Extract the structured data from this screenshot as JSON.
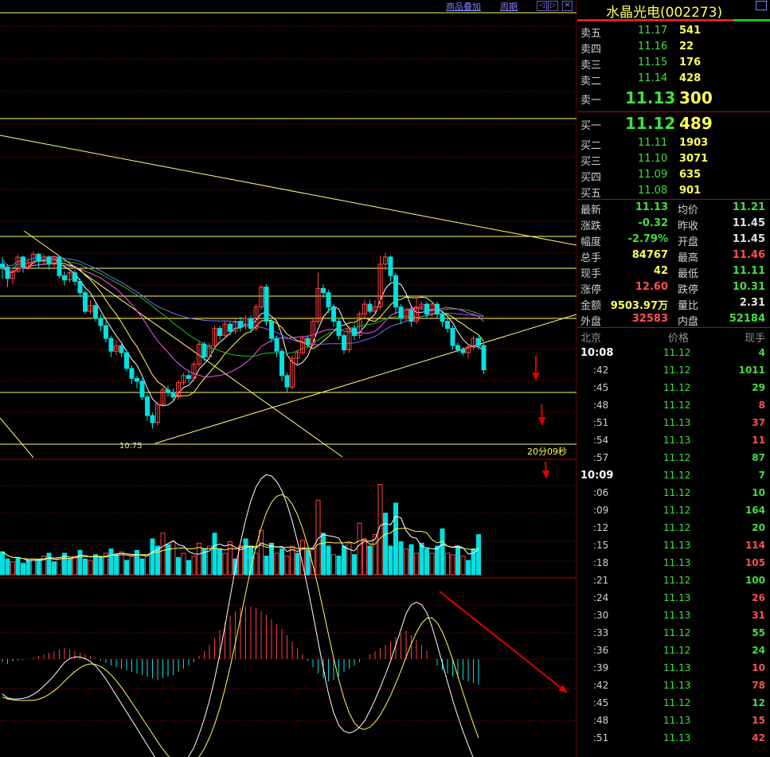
{
  "toolbar": {
    "overlay_label": "商品叠加",
    "period_label": "周期",
    "nav_prev": "◁",
    "nav_next": "▷",
    "nav_close": "✕"
  },
  "chart": {
    "low_label": "10.75",
    "countdown_label": "20分09秒"
  },
  "quote": {
    "title": "水晶光电(002273)",
    "sell": [
      {
        "label": "卖五",
        "price": "11.17",
        "qty": "541"
      },
      {
        "label": "卖四",
        "price": "11.16",
        "qty": "22"
      },
      {
        "label": "卖三",
        "price": "11.15",
        "qty": "176"
      },
      {
        "label": "卖二",
        "price": "11.14",
        "qty": "428"
      },
      {
        "label": "卖一",
        "price": "11.13",
        "qty": "300"
      }
    ],
    "buy": [
      {
        "label": "买一",
        "price": "11.12",
        "qty": "489"
      },
      {
        "label": "买二",
        "price": "11.11",
        "qty": "1903"
      },
      {
        "label": "买三",
        "price": "11.10",
        "qty": "3071"
      },
      {
        "label": "买四",
        "price": "11.09",
        "qty": "635"
      },
      {
        "label": "买五",
        "price": "11.08",
        "qty": "901"
      }
    ],
    "stats": [
      {
        "l1": "最新",
        "v1": "11.13",
        "c1": "g",
        "l2": "均价",
        "v2": "11.21",
        "c2": "g"
      },
      {
        "l1": "涨跌",
        "v1": "-0.32",
        "c1": "g",
        "l2": "昨收",
        "v2": "11.45",
        "c2": "w"
      },
      {
        "l1": "幅度",
        "v1": "-2.79%",
        "c1": "g",
        "l2": "开盘",
        "v2": "11.45",
        "c2": "w"
      },
      {
        "l1": "总手",
        "v1": "84767",
        "c1": "y",
        "l2": "最高",
        "v2": "11.46",
        "c2": "r"
      },
      {
        "l1": "现手",
        "v1": "42",
        "c1": "y",
        "l2": "最低",
        "v2": "11.11",
        "c2": "g"
      },
      {
        "l1": "涨停",
        "v1": "12.60",
        "c1": "r",
        "l2": "跌停",
        "v2": "10.31",
        "c2": "g"
      },
      {
        "l1": "金额",
        "v1": "9503.97万",
        "c1": "y",
        "l2": "量比",
        "v2": "2.31",
        "c2": "w"
      },
      {
        "l1": "外盘",
        "v1": "32583",
        "c1": "r",
        "l2": "内盘",
        "v2": "52184",
        "c2": "g"
      }
    ],
    "ticks_header": {
      "time": "北京",
      "price": "价格",
      "vol": "现手"
    },
    "ticks": [
      {
        "time": "10:08",
        "price": "11.12",
        "vol": "4",
        "c": "g",
        "hour": true
      },
      {
        "time": ":42",
        "price": "11.12",
        "vol": "1011",
        "c": "g"
      },
      {
        "time": ":45",
        "price": "11.12",
        "vol": "29",
        "c": "g"
      },
      {
        "time": ":48",
        "price": "11.12",
        "vol": "8",
        "c": "r"
      },
      {
        "time": ":51",
        "price": "11.13",
        "vol": "37",
        "c": "r"
      },
      {
        "time": ":54",
        "price": "11.13",
        "vol": "11",
        "c": "r"
      },
      {
        "time": ":57",
        "price": "11.12",
        "vol": "87",
        "c": "g"
      },
      {
        "time": "10:09",
        "price": "11.12",
        "vol": "7",
        "c": "g",
        "hour": true
      },
      {
        "time": ":06",
        "price": "11.12",
        "vol": "10",
        "c": "g"
      },
      {
        "time": ":09",
        "price": "11.12",
        "vol": "164",
        "c": "g"
      },
      {
        "time": ":12",
        "price": "11.12",
        "vol": "20",
        "c": "g"
      },
      {
        "time": ":15",
        "price": "11.13",
        "vol": "114",
        "c": "r"
      },
      {
        "time": ":18",
        "price": "11.13",
        "vol": "105",
        "c": "r"
      },
      {
        "time": ":21",
        "price": "11.12",
        "vol": "100",
        "c": "g"
      },
      {
        "time": ":24",
        "price": "11.13",
        "vol": "26",
        "c": "r"
      },
      {
        "time": ":30",
        "price": "11.13",
        "vol": "31",
        "c": "r"
      },
      {
        "time": ":33",
        "price": "11.12",
        "vol": "55",
        "c": "g"
      },
      {
        "time": ":36",
        "price": "11.12",
        "vol": "24",
        "c": "g"
      },
      {
        "time": ":39",
        "price": "11.13",
        "vol": "10",
        "c": "r"
      },
      {
        "time": ":42",
        "price": "11.13",
        "vol": "78",
        "c": "r"
      },
      {
        "time": ":45",
        "price": "11.12",
        "vol": "12",
        "c": "g"
      },
      {
        "time": ":48",
        "price": "11.13",
        "vol": "15",
        "c": "r"
      },
      {
        "time": ":51",
        "price": "11.13",
        "vol": "42",
        "c": "r"
      }
    ]
  },
  "colors": {
    "up": "#ff4040",
    "down": "#00e0e0",
    "ma5": "#ffffff",
    "ma10": "#ffff54",
    "ma20": "#ff50ff",
    "ma30": "#20c020",
    "ma60": "#7070ff",
    "trend": "#ffff80",
    "grid": "#900000",
    "annot": "#e00000",
    "price_green": "#40e040",
    "volume_gold": "#ffff54"
  },
  "chart_data": {
    "type": "candlestick",
    "candles": [
      [
        11.9,
        11.88,
        11.95,
        11.8
      ],
      [
        11.88,
        11.8,
        11.9,
        11.74
      ],
      [
        11.8,
        11.85,
        11.88,
        11.76
      ],
      [
        11.85,
        11.95,
        11.97,
        11.84
      ],
      [
        11.95,
        11.88,
        11.96,
        11.84
      ],
      [
        11.88,
        11.91,
        11.94,
        11.86
      ],
      [
        11.91,
        11.97,
        11.99,
        11.9
      ],
      [
        11.97,
        11.92,
        11.98,
        11.87
      ],
      [
        11.92,
        11.95,
        11.97,
        11.89
      ],
      [
        11.95,
        11.9,
        11.96,
        11.86
      ],
      [
        11.9,
        11.95,
        11.96,
        11.87
      ],
      [
        11.95,
        11.82,
        11.96,
        11.8
      ],
      [
        11.82,
        11.79,
        11.85,
        11.75
      ],
      [
        11.79,
        11.84,
        11.86,
        11.77
      ],
      [
        11.84,
        11.78,
        11.86,
        11.75
      ],
      [
        11.78,
        11.7,
        11.8,
        11.67
      ],
      [
        11.7,
        11.57,
        11.72,
        11.55
      ],
      [
        11.57,
        11.61,
        11.65,
        11.55
      ],
      [
        11.61,
        11.52,
        11.63,
        11.5
      ],
      [
        11.52,
        11.47,
        11.55,
        11.43
      ],
      [
        11.47,
        11.38,
        11.5,
        11.35
      ],
      [
        11.38,
        11.29,
        11.4,
        11.25
      ],
      [
        11.29,
        11.33,
        11.37,
        11.26
      ],
      [
        11.33,
        11.28,
        11.35,
        11.25
      ],
      [
        11.28,
        11.17,
        11.3,
        11.15
      ],
      [
        11.17,
        11.1,
        11.19,
        11.06
      ],
      [
        11.1,
        11.08,
        11.12,
        11.03
      ],
      [
        11.08,
        10.97,
        11.1,
        10.95
      ],
      [
        10.97,
        10.84,
        10.99,
        10.8
      ],
      [
        10.84,
        10.79,
        10.86,
        10.75
      ],
      [
        10.79,
        10.92,
        10.94,
        10.77
      ],
      [
        10.92,
        11.02,
        11.04,
        10.9
      ],
      [
        11.02,
        11.0,
        11.05,
        10.97
      ],
      [
        11.0,
        10.97,
        11.03,
        10.94
      ],
      [
        10.97,
        11.07,
        11.09,
        10.95
      ],
      [
        11.07,
        11.12,
        11.14,
        11.05
      ],
      [
        11.12,
        11.1,
        11.15,
        11.07
      ],
      [
        11.1,
        11.2,
        11.22,
        11.08
      ],
      [
        11.2,
        11.34,
        11.36,
        11.18
      ],
      [
        11.34,
        11.25,
        11.36,
        11.22
      ],
      [
        11.25,
        11.33,
        11.35,
        11.23
      ],
      [
        11.33,
        11.45,
        11.47,
        11.31
      ],
      [
        11.45,
        11.4,
        11.47,
        11.37
      ],
      [
        11.4,
        11.48,
        11.5,
        11.38
      ],
      [
        11.48,
        11.43,
        11.5,
        11.4
      ],
      [
        11.43,
        11.5,
        11.52,
        11.41
      ],
      [
        11.5,
        11.46,
        11.53,
        11.43
      ],
      [
        11.46,
        11.52,
        11.54,
        11.44
      ],
      [
        11.52,
        11.45,
        11.54,
        11.42
      ],
      [
        11.45,
        11.6,
        11.62,
        11.43
      ],
      [
        11.6,
        11.74,
        11.75,
        11.58
      ],
      [
        11.74,
        11.5,
        11.76,
        11.47
      ],
      [
        11.5,
        11.38,
        11.52,
        11.35
      ],
      [
        11.38,
        11.29,
        11.4,
        11.25
      ],
      [
        11.29,
        11.12,
        11.31,
        11.08
      ],
      [
        11.12,
        11.04,
        11.14,
        11.0
      ],
      [
        11.04,
        11.24,
        11.26,
        11.02
      ],
      [
        11.24,
        11.28,
        11.3,
        11.2
      ],
      [
        11.28,
        11.38,
        11.4,
        11.26
      ],
      [
        11.38,
        11.34,
        11.4,
        11.31
      ],
      [
        11.34,
        11.5,
        11.52,
        11.32
      ],
      [
        11.5,
        11.73,
        11.84,
        11.48
      ],
      [
        11.73,
        11.7,
        11.76,
        11.66
      ],
      [
        11.7,
        11.6,
        11.72,
        11.56
      ],
      [
        11.6,
        11.5,
        11.62,
        11.46
      ],
      [
        11.5,
        11.4,
        11.52,
        11.37
      ],
      [
        11.4,
        11.3,
        11.42,
        11.27
      ],
      [
        11.3,
        11.45,
        11.47,
        11.28
      ],
      [
        11.45,
        11.4,
        11.48,
        11.37
      ],
      [
        11.4,
        11.55,
        11.57,
        11.38
      ],
      [
        11.55,
        11.62,
        11.65,
        11.52
      ],
      [
        11.62,
        11.57,
        11.65,
        11.55
      ],
      [
        11.57,
        11.6,
        11.65,
        11.55
      ],
      [
        11.6,
        11.9,
        11.96,
        11.58
      ],
      [
        11.9,
        11.95,
        11.98,
        11.86
      ],
      [
        11.95,
        11.82,
        11.96,
        11.78
      ],
      [
        11.82,
        11.6,
        11.84,
        11.55
      ],
      [
        11.6,
        11.52,
        11.62,
        11.48
      ],
      [
        11.52,
        11.58,
        11.6,
        11.5
      ],
      [
        11.58,
        11.5,
        11.6,
        11.46
      ],
      [
        11.5,
        11.6,
        11.68,
        11.48
      ],
      [
        11.6,
        11.62,
        11.64,
        11.58
      ],
      [
        11.62,
        11.55,
        11.64,
        11.52
      ],
      [
        11.55,
        11.62,
        11.64,
        11.53
      ],
      [
        11.62,
        11.55,
        11.64,
        11.52
      ],
      [
        11.55,
        11.5,
        11.57,
        11.46
      ],
      [
        11.5,
        11.45,
        11.52,
        11.42
      ],
      [
        11.45,
        11.33,
        11.47,
        11.3
      ],
      [
        11.33,
        11.3,
        11.35,
        11.28
      ],
      [
        11.3,
        11.28,
        11.32,
        11.26
      ],
      [
        11.28,
        11.32,
        11.34,
        11.24
      ],
      [
        11.32,
        11.38,
        11.4,
        11.3
      ],
      [
        11.38,
        11.33,
        11.4,
        11.3
      ],
      [
        11.33,
        11.16,
        11.35,
        11.13
      ]
    ],
    "volume": [
      [
        32,
        "d"
      ],
      [
        22,
        "d"
      ],
      [
        18,
        "u"
      ],
      [
        24,
        "d"
      ],
      [
        16,
        "d"
      ],
      [
        20,
        "d"
      ],
      [
        22,
        "u"
      ],
      [
        20,
        "d"
      ],
      [
        26,
        "u"
      ],
      [
        30,
        "d"
      ],
      [
        18,
        "d"
      ],
      [
        24,
        "u"
      ],
      [
        30,
        "d"
      ],
      [
        22,
        "d"
      ],
      [
        26,
        "u"
      ],
      [
        34,
        "d"
      ],
      [
        22,
        "d"
      ],
      [
        20,
        "u"
      ],
      [
        28,
        "d"
      ],
      [
        24,
        "d"
      ],
      [
        30,
        "u"
      ],
      [
        36,
        "d"
      ],
      [
        28,
        "d"
      ],
      [
        32,
        "u"
      ],
      [
        20,
        "d"
      ],
      [
        26,
        "u"
      ],
      [
        34,
        "d"
      ],
      [
        22,
        "d"
      ],
      [
        28,
        "u"
      ],
      [
        50,
        "d"
      ],
      [
        40,
        "d"
      ],
      [
        58,
        "u"
      ],
      [
        42,
        "d"
      ],
      [
        46,
        "u"
      ],
      [
        24,
        "d"
      ],
      [
        30,
        "u"
      ],
      [
        20,
        "d"
      ],
      [
        26,
        "u"
      ],
      [
        44,
        "u"
      ],
      [
        36,
        "d"
      ],
      [
        40,
        "u"
      ],
      [
        58,
        "d"
      ],
      [
        36,
        "d"
      ],
      [
        30,
        "u"
      ],
      [
        46,
        "u"
      ],
      [
        22,
        "d"
      ],
      [
        40,
        "u"
      ],
      [
        50,
        "d"
      ],
      [
        40,
        "d"
      ],
      [
        30,
        "u"
      ],
      [
        62,
        "u"
      ],
      [
        26,
        "d"
      ],
      [
        44,
        "d"
      ],
      [
        30,
        "u"
      ],
      [
        36,
        "d"
      ],
      [
        26,
        "u"
      ],
      [
        40,
        "u"
      ],
      [
        30,
        "d"
      ],
      [
        48,
        "u"
      ],
      [
        34,
        "d"
      ],
      [
        36,
        "u"
      ],
      [
        104,
        "u"
      ],
      [
        58,
        "d"
      ],
      [
        40,
        "d"
      ],
      [
        28,
        "u"
      ],
      [
        26,
        "d"
      ],
      [
        40,
        "d"
      ],
      [
        44,
        "u"
      ],
      [
        28,
        "d"
      ],
      [
        72,
        "u"
      ],
      [
        50,
        "u"
      ],
      [
        40,
        "d"
      ],
      [
        56,
        "u"
      ],
      [
        126,
        "u"
      ],
      [
        86,
        "d"
      ],
      [
        40,
        "d"
      ],
      [
        100,
        "d"
      ],
      [
        46,
        "d"
      ],
      [
        36,
        "u"
      ],
      [
        42,
        "d"
      ],
      [
        30,
        "u"
      ],
      [
        44,
        "d"
      ],
      [
        36,
        "d"
      ],
      [
        30,
        "u"
      ],
      [
        40,
        "d"
      ],
      [
        64,
        "d"
      ],
      [
        30,
        "u"
      ],
      [
        28,
        "u"
      ],
      [
        40,
        "d"
      ],
      [
        26,
        "u"
      ],
      [
        20,
        "d"
      ],
      [
        36,
        "d"
      ],
      [
        56,
        "d"
      ]
    ],
    "macd_hist": [
      -4,
      -6,
      -3,
      -2,
      -1,
      0,
      2,
      4,
      6,
      8,
      10,
      12,
      14,
      12,
      10,
      8,
      6,
      4,
      1,
      -2,
      -5,
      -8,
      -10,
      -12,
      -14,
      -16,
      -18,
      -20,
      -22,
      -24,
      -26,
      -24,
      -22,
      -20,
      -16,
      -12,
      -8,
      -4,
      4,
      10,
      18,
      26,
      36,
      46,
      54,
      60,
      64,
      66,
      66,
      64,
      60,
      56,
      50,
      44,
      38,
      30,
      22,
      14,
      6,
      -2,
      -10,
      -18,
      -24,
      -28,
      -26,
      -22,
      -16,
      -12,
      -8,
      -4,
      0,
      6,
      10,
      14,
      18,
      22,
      28,
      32,
      36,
      30,
      24,
      18,
      10,
      0,
      -8,
      -14,
      -18,
      -22,
      -24,
      -26,
      -28,
      -30,
      -32
    ]
  }
}
